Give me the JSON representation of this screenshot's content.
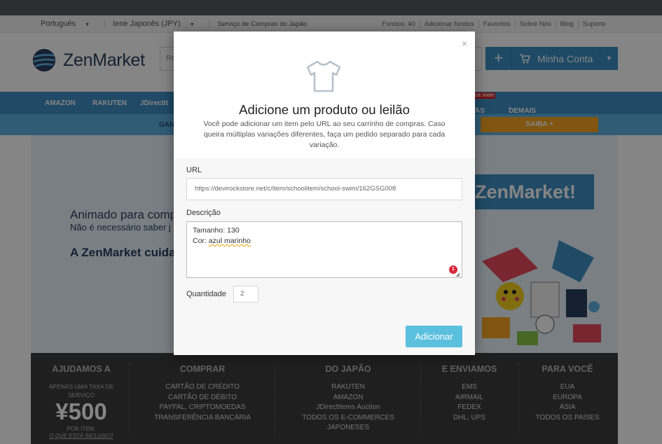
{
  "topbar": {
    "language": "Português",
    "currency": "Iene Japonês (JPY)",
    "service": "Serviço de Compras do Japão",
    "links": [
      "Fundos: ¥0",
      "Adicionar fundos",
      "Favoritos",
      "Sobre Nós",
      "Blog",
      "Suporte"
    ]
  },
  "header": {
    "logo_text": "ZenMarket",
    "search_placeholder": "Ra",
    "account_label": "Minha Conta"
  },
  "nav": {
    "items": [
      "AMAZON",
      "RAKUTEN",
      "JDirectIt",
      "AS",
      "DEMAIS LOJAS"
    ],
    "badge": "DE ¥500!"
  },
  "subbar": {
    "left": "GAN",
    "button": "SAIBA +"
  },
  "hero": {
    "line1": "Animado para comp",
    "line2": "Não é necessário saber j",
    "line3": "A ZenMarket cuida",
    "badge": "ZenMarket!"
  },
  "footer": {
    "col1": {
      "title": "AJUDAMOS A",
      "small": "APENAS UMA TAXA DE SERVIÇO",
      "price": "¥500",
      "per_item": "POR ITEM.",
      "link": "O QUE ESTÁ INCLUSO?"
    },
    "col2": {
      "title": "COMPRAR",
      "items": [
        "CARTÃO DE CRÉDITO",
        "CARTÃO DE DÉBITO",
        "PAYPAL, CRIPTOMOEDAS",
        "TRANSFERÊNCIA BANCÁRIA"
      ]
    },
    "col3": {
      "title": "DO JAPÃO",
      "items": [
        "RAKUTEN",
        "AMAZON",
        "JDirectItems Auction",
        "TODOS OS E-COMMERCES JAPONESES"
      ]
    },
    "col4": {
      "title": "E ENVIAMOS",
      "items": [
        "EMS",
        "AIRMAIL",
        "FEDEX",
        "DHL, UPS"
      ]
    },
    "col5": {
      "title": "PARA VOCÊ",
      "items": [
        "EUA",
        "EUROPA",
        "ÁSIA",
        "TODOS OS PAÍSES"
      ]
    }
  },
  "modal": {
    "close": "×",
    "title": "Adicione um produto ou leilão",
    "description": "Você pode adicionar um item pelo URL ao seu carrinho de compras. Caso queira múltiplas variações diferentes, faça um pedido separado para cada variação.",
    "url_label": "URL",
    "url_value": "https://devirockstore.net/c/item/schoolitem/school-swim/162GSG008",
    "desc_label": "Descrição",
    "desc_line1": "Tamanho: 130",
    "desc_line2_prefix": "Cor: ",
    "desc_line2_underlined": "azul marinho",
    "grammar_count": "1",
    "qty_label": "Quantidade",
    "qty_value": "2",
    "add_button": "Adicionar"
  }
}
